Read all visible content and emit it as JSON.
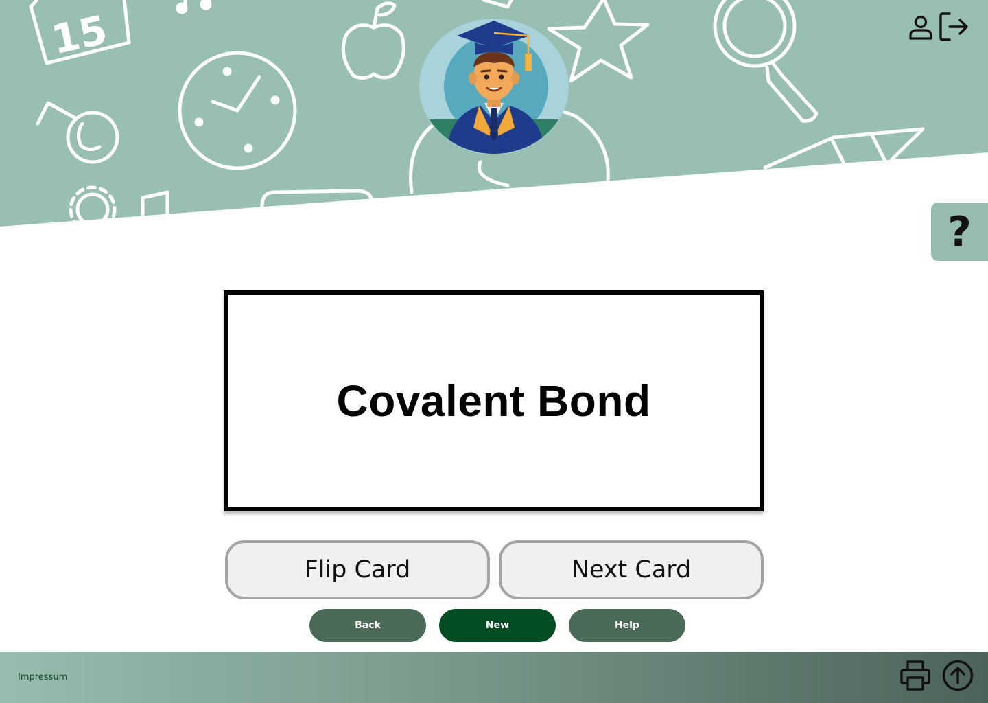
{
  "header": {
    "profile_icon": "user-icon",
    "logout_icon": "logout-icon",
    "banner_color": "#98bfb1"
  },
  "help_tab": {
    "label": "?"
  },
  "flashcard": {
    "term": "Covalent Bond"
  },
  "actions": {
    "flip_label": "Flip Card",
    "next_label": "Next Card"
  },
  "nav": {
    "back_label": "Back",
    "new_label": "New",
    "help_label": "Help"
  },
  "footer": {
    "impressum_label": "Impressum",
    "print_icon": "printer-icon",
    "scroll_top_icon": "arrow-up-circle-icon"
  },
  "colors": {
    "accent_dark": "#024d22",
    "accent_muted": "#4c6a58",
    "button_border": "#a6a3a7"
  }
}
